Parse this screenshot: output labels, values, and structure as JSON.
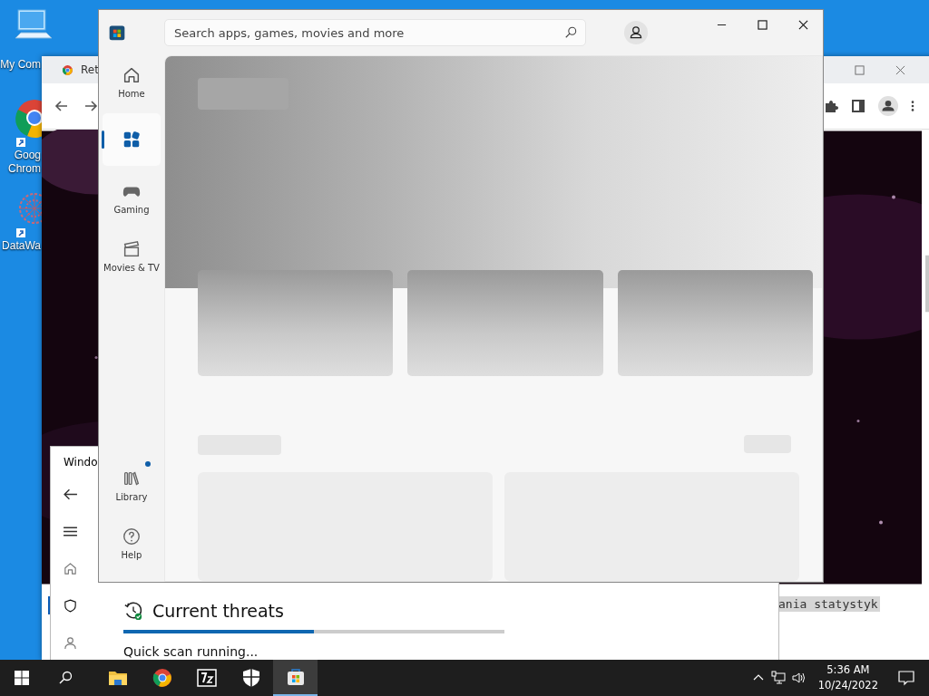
{
  "desktop": {
    "icons": [
      {
        "kind": "computer",
        "lines": [
          "My Com"
        ]
      },
      {
        "kind": "chrome",
        "lines": [
          "Goog",
          "Chrom"
        ]
      },
      {
        "kind": "network",
        "lines": [
          "DataWa"
        ]
      }
    ]
  },
  "browser": {
    "tab_title": "Ret",
    "page_text": "ania statystyk"
  },
  "defender": {
    "title": "Windo",
    "nav": [
      {
        "kind": "home",
        "selected": false
      },
      {
        "kind": "shield",
        "selected": true
      },
      {
        "kind": "person",
        "selected": false
      }
    ],
    "section_title": "Current threats",
    "scan": {
      "level": 0.5
    },
    "status": "Quick scan running..."
  },
  "store": {
    "search": {
      "placeholder": "Search apps, games, movies and more"
    },
    "nav": [
      {
        "kind": "home",
        "label": "Home",
        "selected": false
      },
      {
        "kind": "apps",
        "selected": true
      },
      {
        "kind": "gaming",
        "label": "Gaming",
        "selected": false
      },
      {
        "kind": "movies",
        "label": "Movies & TV",
        "selected": false
      }
    ],
    "bottom_nav": [
      {
        "kind": "library",
        "label": "Library",
        "badge": true
      },
      {
        "kind": "help",
        "label": "Help",
        "badge": false
      }
    ]
  },
  "taskbar": {
    "apps": [
      {
        "kind": "folder",
        "selected": false
      },
      {
        "kind": "chrome",
        "selected": false
      },
      {
        "kind": "zip",
        "selected": false
      },
      {
        "kind": "shield",
        "selected": false
      },
      {
        "kind": "store",
        "selected": true
      }
    ],
    "time": "5:36 AM",
    "date": "10/24/2022"
  }
}
